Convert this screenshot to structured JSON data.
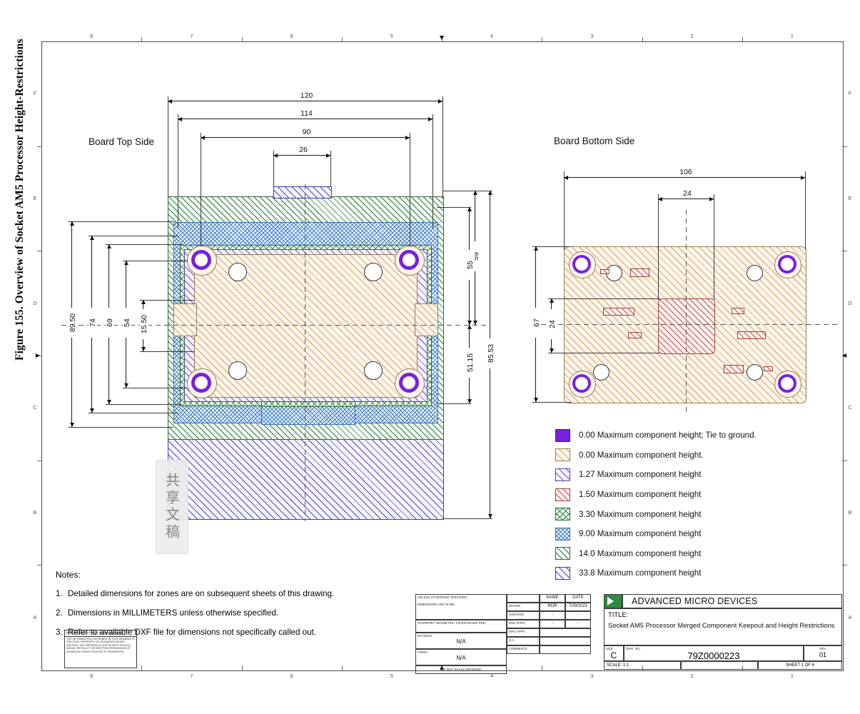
{
  "figure": {
    "caption": "Figure 155. Overview of Socket AM5 Processor Height-Restrictions"
  },
  "sheet": {
    "zones_top": [
      "8",
      "7",
      "6",
      "5",
      "4",
      "3",
      "2",
      "1"
    ],
    "zones_bottom": [
      "8",
      "7",
      "6",
      "5",
      "4",
      "3",
      "2",
      "1"
    ],
    "zones_left": [
      "F",
      "E",
      "D",
      "C",
      "B",
      "A"
    ],
    "zones_right": [
      "F",
      "E",
      "D",
      "C",
      "B",
      "A"
    ]
  },
  "views": {
    "top": {
      "label": "Board Top Side",
      "dims_horizontal": [
        "120",
        "114",
        "90",
        "26"
      ],
      "dims_left": [
        "89.50",
        "74",
        "69",
        "54",
        "15.50"
      ],
      "dims_right": [
        "59",
        "55",
        "51.15",
        "85.53"
      ]
    },
    "bottom": {
      "label": "Board Bottom Side",
      "dims_horizontal": [
        "106",
        "24"
      ],
      "dims_left": [
        "67",
        "24"
      ]
    }
  },
  "legend": [
    {
      "swatch": "purple-solid",
      "color": "#7a20e0",
      "text": "0.00 Maximum component height; Tie to ground."
    },
    {
      "swatch": "tan-diag",
      "color": "#d9a066",
      "text": "0.00 Maximum component height."
    },
    {
      "swatch": "violet-diag",
      "color": "#6a4fd0",
      "text": "1.27 Maximum component height"
    },
    {
      "swatch": "red-diag",
      "color": "#c9504a",
      "text": "1.50 Maximum component height"
    },
    {
      "swatch": "green-cross",
      "color": "#2f8a40",
      "text": "3.30 Maximum component height"
    },
    {
      "swatch": "blue-zig",
      "color": "#3f7fd0",
      "text": "9.00 Maximum component height"
    },
    {
      "swatch": "green-diag",
      "color": "#2f7d3f",
      "text": "14.0 Maximum component height"
    },
    {
      "swatch": "blueviolet-diag",
      "color": "#4a46c8",
      "text": "33.8 Maximum component height"
    }
  ],
  "notes": {
    "heading": "Notes:",
    "items": [
      {
        "num": "1.",
        "text": "Detailed dimensions for zones are on subsequent sheets of this drawing."
      },
      {
        "num": "2.",
        "text": "Dimensions in MILLIMETERS unless otherwise specified."
      },
      {
        "num": "3.",
        "text": "Refer to available DXF file for dimensions not specifically called out."
      }
    ]
  },
  "watermark": {
    "text": "共享文稿"
  },
  "title_block": {
    "proprietary_heading": "PROPRIETARY AND CONFIDENTIAL",
    "proprietary_body": "THE INFORMATION CONTAINED IN THIS DRAWING IS THE SOLE PROPERTY OF ADVANCED MICRO DEVICES.  ANY REPRODUCTION IN PART OR AS A WHOLE WITHOUT THE WRITTEN PERMISSION OF ADVANCED MICRO DEVICES IS PROHIBITED.",
    "unless_specified": "UNLESS OTHERWISE SPECIFIED:",
    "dimensions_are": "DIMENSIONS ARE IN MM",
    "interpret": "INTERPRET GEOMETRIC TOLERANCING PER:",
    "material_label": "MATERIAL",
    "material_value": "N/A",
    "finish_label": "FINISH",
    "finish_value": "N/A",
    "do_not_scale": "DO NOT SCALE DRAWING",
    "col_name": "NAME",
    "col_date": "DATE",
    "rows": [
      {
        "label": "DRAWN",
        "name": "RDR",
        "date": "7/29/2021"
      },
      {
        "label": "CHECKED",
        "name": "-",
        "date": "-"
      },
      {
        "label": "ENG APPR.",
        "name": "-",
        "date": "-"
      },
      {
        "label": "MFG APPR.",
        "name": "",
        "date": ""
      },
      {
        "label": "Q.A.",
        "name": "",
        "date": ""
      },
      {
        "label": "COMMENTS:",
        "name": "",
        "date": ""
      }
    ],
    "company": "ADVANCED MICRO DEVICES",
    "title_label": "TITLE:",
    "title_text": "Socket AM5 Processor Merged Component Keepout and Height Restrictions",
    "size_label": "SIZE",
    "size_value": "C",
    "dwg_label": "DWG.  NO.",
    "dwg_value": "79Z0000223",
    "rev_label": "REV",
    "rev_value": "01",
    "scale": "SCALE: 1:1",
    "sheet": "SHEET 1 OF 6"
  }
}
